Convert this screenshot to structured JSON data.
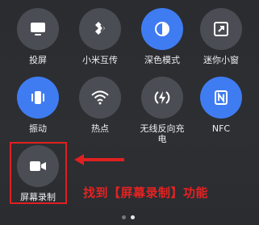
{
  "tiles": [
    {
      "label": "投屏",
      "icon": "monitor-icon",
      "active": false
    },
    {
      "label": "小米互传",
      "icon": "xiaomi-share-icon",
      "active": false
    },
    {
      "label": "深色模式",
      "icon": "dark-mode-icon",
      "active": true
    },
    {
      "label": "迷你小窗",
      "icon": "mini-window-icon",
      "active": false
    },
    {
      "label": "振动",
      "icon": "vibrate-icon",
      "active": true
    },
    {
      "label": "热点",
      "icon": "hotspot-icon",
      "active": false
    },
    {
      "label": "无线反向充电",
      "icon": "reverse-charging-icon",
      "active": false
    },
    {
      "label": "NFC",
      "icon": "nfc-icon",
      "active": true
    },
    {
      "label": "屏幕录制",
      "icon": "screen-record-icon",
      "active": false
    }
  ],
  "annotation": {
    "hint": "找到【屏幕录制】功能",
    "color": "#e02020"
  },
  "pager": {
    "pages": 2,
    "current": 2
  },
  "colors": {
    "active": "#3f7cf2",
    "inactive": "#4a4d53",
    "background": "#2b2d31"
  }
}
